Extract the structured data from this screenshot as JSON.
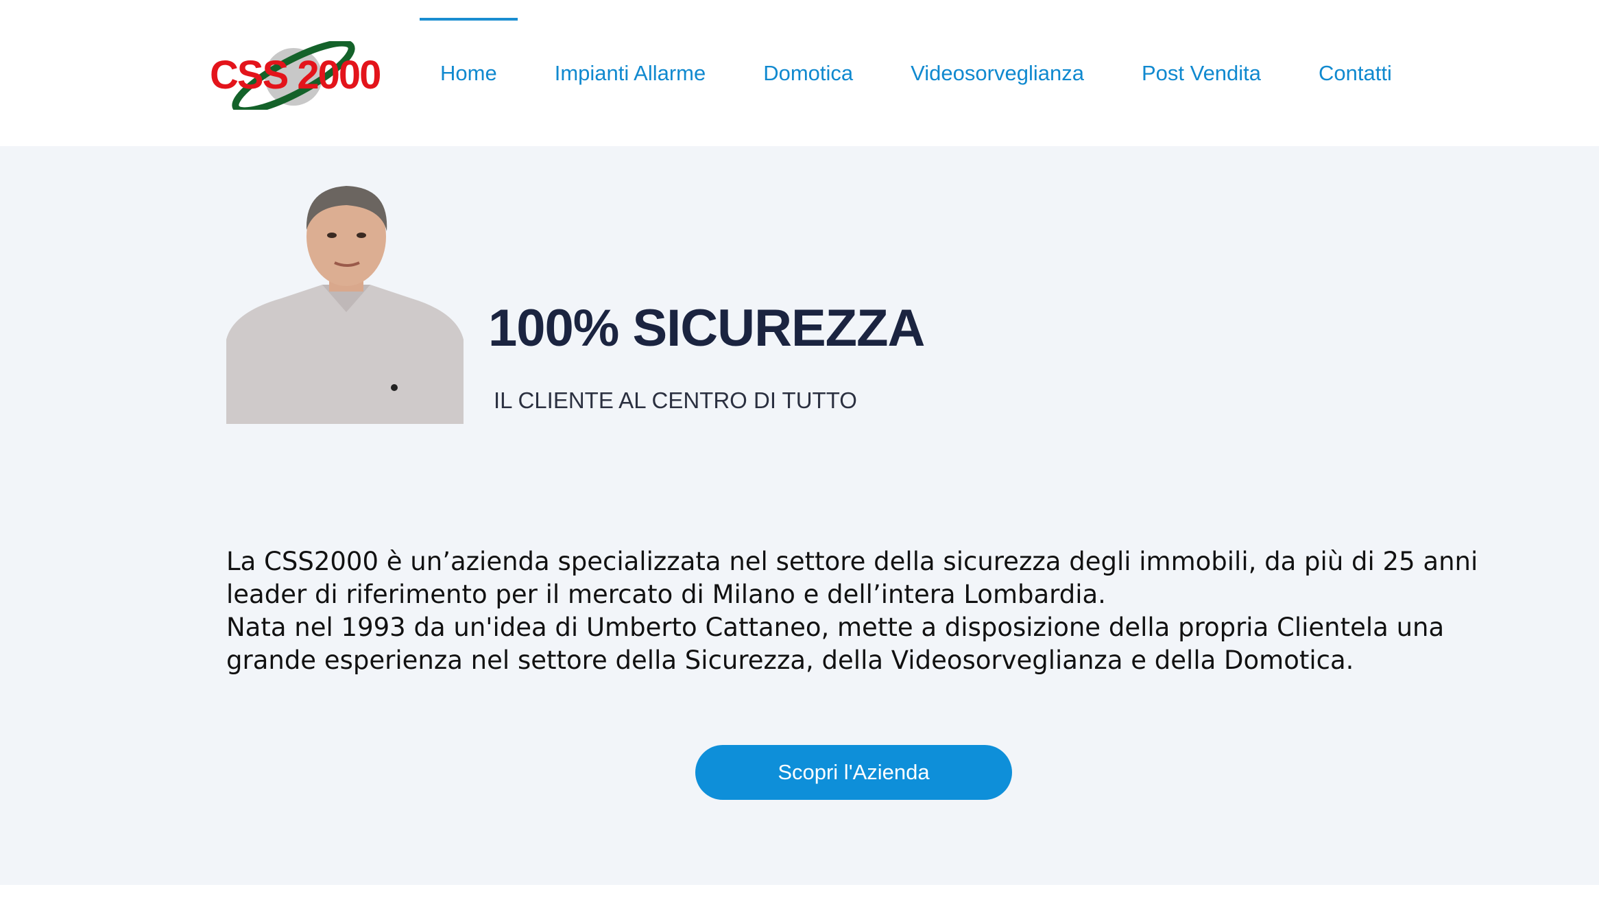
{
  "header": {
    "logo_text": "CSS 2000",
    "nav": [
      {
        "label": "Home",
        "active": true
      },
      {
        "label": "Impianti Allarme"
      },
      {
        "label": "Domotica"
      },
      {
        "label": "Videosorveglianza"
      },
      {
        "label": "Post Vendita"
      },
      {
        "label": "Contatti"
      }
    ]
  },
  "hero": {
    "title": "100% SICUREZZA",
    "subtitle": "IL CLIENTE AL CENTRO DI TUTTO"
  },
  "intro": {
    "paragraph_1": "La CSS2000 è un’azienda specializzata nel settore della sicurezza degli immobili, da più di 25 anni leader di riferimento per il mercato di Milano e dell’intera Lombardia.",
    "paragraph_2": "Nata nel 1993 da un'idea di Umberto Cattaneo, mette a disposizione della propria Clientela una grande esperienza nel settore della Sicurezza, della Videosorveglianza e della Domotica."
  },
  "cta": {
    "label": "Scopri l'Azienda"
  },
  "colors": {
    "nav_text": "#1089cf",
    "logo_red": "#e3141b",
    "title": "#1b2440",
    "band_background": "#f2f5f9",
    "button": "#0e8fd9"
  }
}
